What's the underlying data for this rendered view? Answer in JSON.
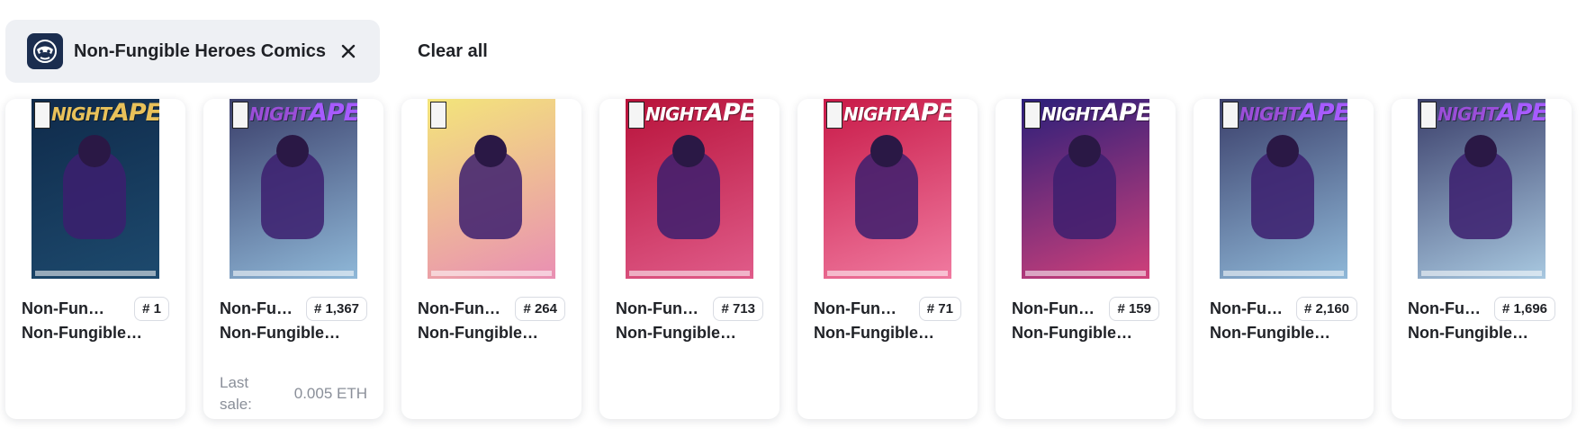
{
  "filters": {
    "active_filter_label": "Non-Fungible Heroes Comics",
    "clear_all_label": "Clear all"
  },
  "cards": [
    {
      "cover_title_left": "NIGHT",
      "cover_title_right": "APE",
      "cover_title_color_left": "#e8c15a",
      "cover_title_color_right": "#e8c15a",
      "cover_bg": "#0f2a4a",
      "cover_bg2": "#1d4a6e",
      "name_primary": "Non-Fungi…",
      "token_id": "# 1",
      "name_secondary": "Non-Fungible…"
    },
    {
      "cover_title_left": "NIGHT",
      "cover_title_right": "APE",
      "cover_title_color_left": "#9b4ed8",
      "cover_title_color_right": "#a75bff",
      "cover_bg": "#3a3e6a",
      "cover_bg2": "#8fb8d8",
      "name_primary": "Non-Fu…",
      "token_id": "# 1,367",
      "name_secondary": "Non-Fungible…",
      "last_sale_label": "Last sale:",
      "last_sale_value": "0.005 ETH"
    },
    {
      "cover_title_left": "",
      "cover_title_right": "",
      "cover_title_color_left": "#111111",
      "cover_title_color_right": "#111111",
      "cover_bg": "#f3e57a",
      "cover_bg2": "#e98fb3",
      "name_primary": "Non-Fun…",
      "token_id": "# 264",
      "name_secondary": "Non-Fungible…"
    },
    {
      "cover_title_left": "NIGHT",
      "cover_title_right": "APE",
      "cover_title_color_left": "#ffffff",
      "cover_title_color_right": "#ffffff",
      "cover_bg": "#b8123a",
      "cover_bg2": "#e05c8a",
      "name_primary": "Non-Fun…",
      "token_id": "# 713",
      "name_secondary": "Non-Fungible…"
    },
    {
      "cover_title_left": "NIGHT",
      "cover_title_right": "APE",
      "cover_title_color_left": "#ffffff",
      "cover_title_color_right": "#ffffff",
      "cover_bg": "#c81a48",
      "cover_bg2": "#f07aa0",
      "name_primary": "Non-Fungi…",
      "token_id": "# 71",
      "name_secondary": "Non-Fungible…"
    },
    {
      "cover_title_left": "NIGHT",
      "cover_title_right": "APE",
      "cover_title_color_left": "#ffffff",
      "cover_title_color_right": "#ffffff",
      "cover_bg": "#2b1f7a",
      "cover_bg2": "#d0407a",
      "name_primary": "Non-Fun…",
      "token_id": "# 159",
      "name_secondary": "Non-Fungible…"
    },
    {
      "cover_title_left": "NIGHT",
      "cover_title_right": "APE",
      "cover_title_color_left": "#9b4ed8",
      "cover_title_color_right": "#a75bff",
      "cover_bg": "#3a3e6a",
      "cover_bg2": "#8fb8d8",
      "name_primary": "Non-Fu…",
      "token_id": "# 2,160",
      "name_secondary": "Non-Fungible…"
    },
    {
      "cover_title_left": "NIGHT",
      "cover_title_right": "APE",
      "cover_title_color_left": "#9b4ed8",
      "cover_title_color_right": "#a75bff",
      "cover_bg": "#3a3e6a",
      "cover_bg2": "#a8c8e0",
      "name_primary": "Non-Fu…",
      "token_id": "# 1,696",
      "name_secondary": "Non-Fungible…"
    }
  ]
}
